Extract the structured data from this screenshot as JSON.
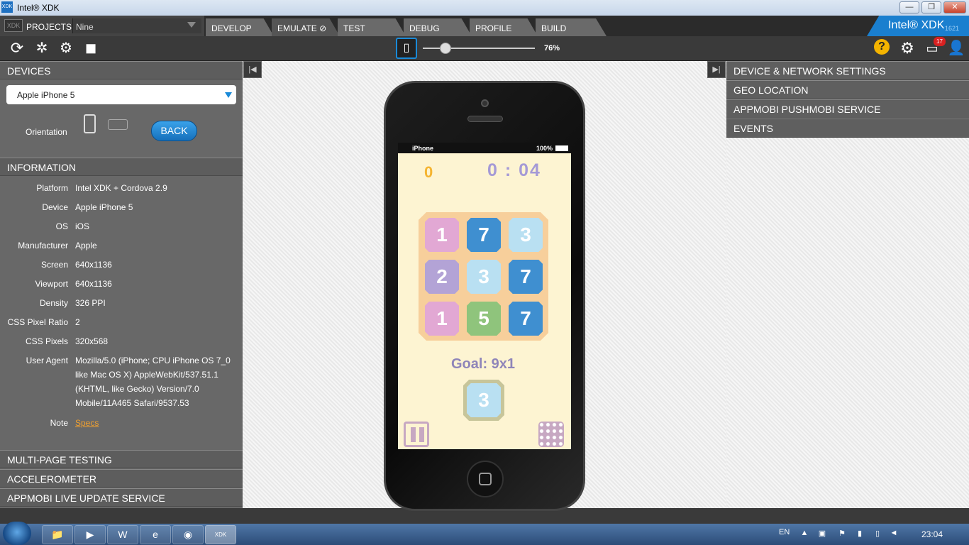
{
  "window": {
    "title": "Intel® XDK",
    "logo": "XDK",
    "buttons": [
      "minimize",
      "restore",
      "close"
    ]
  },
  "projects": {
    "logo": "XDK",
    "label": "PROJECTS",
    "current": "Nine"
  },
  "tabs": [
    {
      "label": "DEVELOP"
    },
    {
      "label": "EMULATE",
      "active": true
    },
    {
      "label": "TEST"
    },
    {
      "label": "DEBUG"
    },
    {
      "label": "PROFILE"
    },
    {
      "label": "BUILD"
    }
  ],
  "brand": {
    "name": "Intel® XDK",
    "build": "1621"
  },
  "toolbar": {
    "zoom": "76%",
    "zoom_level": 0.2,
    "notifications": "17",
    "icons": [
      "reload-icon",
      "debug-icon",
      "debug-alt-icon",
      "stop-icon",
      "device-frame-icon",
      "help-icon",
      "settings-icon",
      "notifications-icon",
      "user-icon"
    ]
  },
  "devices": {
    "header": "DEVICES",
    "selected": "Apple iPhone 5",
    "orientation_label": "Orientation",
    "back_label": "BACK"
  },
  "information": {
    "header": "INFORMATION",
    "rows": [
      {
        "label": "Platform",
        "value": "Intel XDK + Cordova 2.9"
      },
      {
        "label": "Device",
        "value": "Apple iPhone 5"
      },
      {
        "label": "OS",
        "value": "iOS"
      },
      {
        "label": "Manufacturer",
        "value": "Apple"
      },
      {
        "label": "Screen",
        "value": "640x1136"
      },
      {
        "label": "Viewport",
        "value": "640x1136"
      },
      {
        "label": "Density",
        "value": "326 PPI"
      },
      {
        "label": "CSS Pixel Ratio",
        "value": "2"
      },
      {
        "label": "CSS Pixels",
        "value": "320x568"
      },
      {
        "label": "User Agent",
        "value": "Mozilla/5.0 (iPhone; CPU iPhone OS 7_0 like Mac OS X) AppleWebKit/537.51.1 (KHTML, like Gecko) Version/7.0 Mobile/11A465 Safari/9537.53"
      }
    ],
    "note_label": "Note",
    "note_link": "Specs"
  },
  "left_sections": [
    "MULTI-PAGE TESTING",
    "ACCELEROMETER",
    "APPMOBI LIVE UPDATE SERVICE"
  ],
  "right_sections": [
    "DEVICE & NETWORK SETTINGS",
    "GEO LOCATION",
    "APPMOBI PUSHMOBI SERVICE",
    "EVENTS"
  ],
  "phone": {
    "carrier": "iPhone",
    "battery": "100%",
    "score": "0",
    "timer": "0 : 04",
    "grid": [
      {
        "n": "1",
        "color": "#e2a8d4"
      },
      {
        "n": "7",
        "color": "#3f8fd0"
      },
      {
        "n": "3",
        "color": "#b9e0f2"
      },
      {
        "n": "2",
        "color": "#b3a3d6"
      },
      {
        "n": "3",
        "color": "#b9e0f2"
      },
      {
        "n": "7",
        "color": "#3f8fd0"
      },
      {
        "n": "1",
        "color": "#e2a8d4"
      },
      {
        "n": "5",
        "color": "#8fc47c"
      },
      {
        "n": "7",
        "color": "#3f8fd0"
      }
    ],
    "goal": "Goal: 9x1",
    "goal_tile": "3"
  },
  "taskbar": {
    "apps": [
      {
        "name": "explorer-icon",
        "glyph": "📁"
      },
      {
        "name": "media-player-icon",
        "glyph": "▶"
      },
      {
        "name": "word-icon",
        "glyph": "W"
      },
      {
        "name": "ie-icon",
        "glyph": "e"
      },
      {
        "name": "chrome-icon",
        "glyph": "◉"
      },
      {
        "name": "xdk-icon",
        "glyph": "XDK"
      }
    ],
    "lang": "EN",
    "time": "23:04"
  }
}
